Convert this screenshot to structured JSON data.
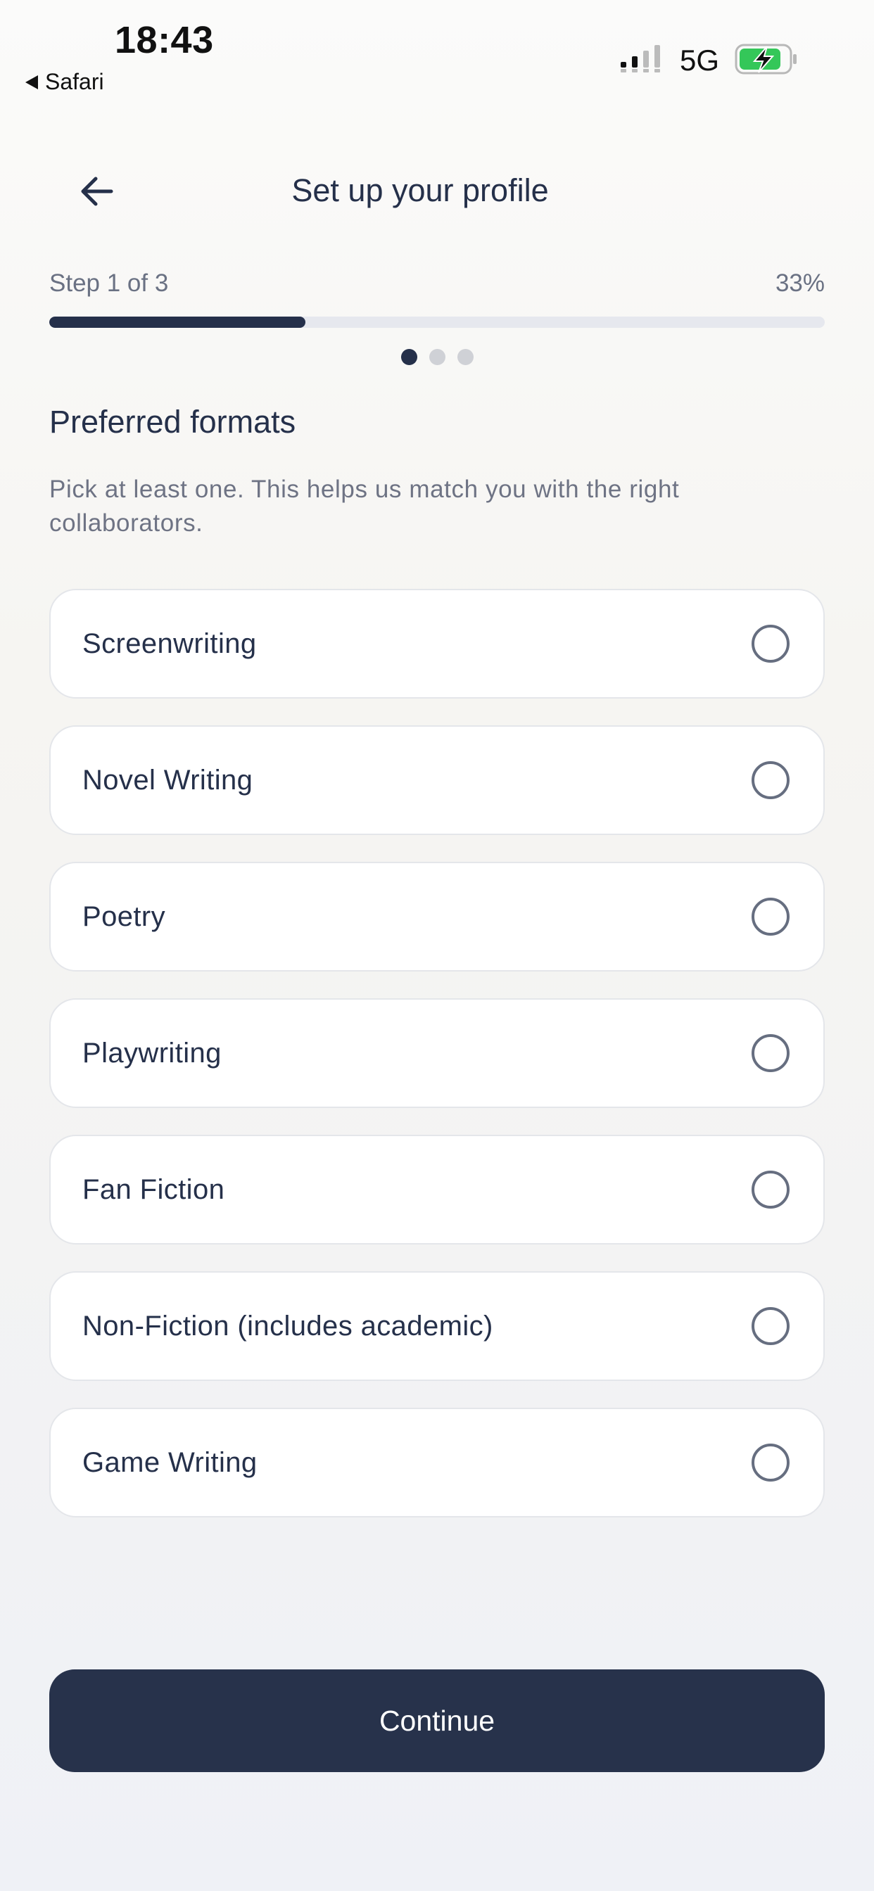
{
  "status_bar": {
    "time": "18:43",
    "back_app": "Safari",
    "network": "5G"
  },
  "header": {
    "title": "Set up your profile"
  },
  "progress": {
    "step_label": "Step 1 of 3",
    "percent_label": "33%",
    "fraction": 0.33,
    "current_step": 1,
    "total_steps": 3
  },
  "section": {
    "title": "Preferred formats",
    "description": "Pick at least one. This helps us match you with the right collaborators."
  },
  "options": [
    {
      "label": "Screenwriting",
      "selected": false
    },
    {
      "label": "Novel Writing",
      "selected": false
    },
    {
      "label": "Poetry",
      "selected": false
    },
    {
      "label": "Playwriting",
      "selected": false
    },
    {
      "label": "Fan Fiction",
      "selected": false
    },
    {
      "label": "Non-Fiction (includes academic)",
      "selected": false
    },
    {
      "label": "Game Writing",
      "selected": false
    }
  ],
  "actions": {
    "continue_label": "Continue"
  },
  "colors": {
    "primary": "#27324b",
    "muted_text": "#6e7384",
    "battery_fill": "#34c759"
  },
  "icons": {
    "back": "arrow-left-icon",
    "radio": "radio-unchecked-icon",
    "signal": "cellular-signal-icon",
    "battery": "battery-charging-icon"
  }
}
